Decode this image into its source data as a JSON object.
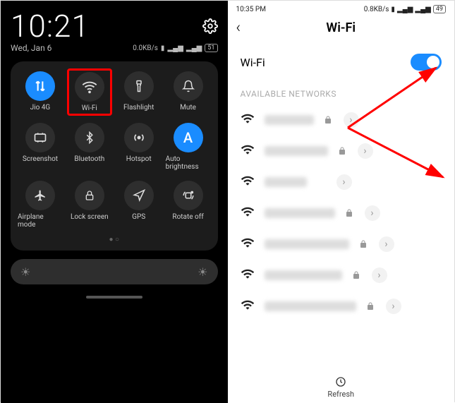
{
  "left": {
    "clock": "10:21",
    "date": "Wed, Jan 6",
    "data_rate": "0.0KB/s",
    "battery": "51",
    "tiles": [
      {
        "label": "Jio 4G",
        "icon": "updown",
        "active": true,
        "highlight": false
      },
      {
        "label": "Wi-Fi",
        "icon": "wifi",
        "active": false,
        "highlight": true
      },
      {
        "label": "Flashlight",
        "icon": "torch",
        "active": false,
        "highlight": false
      },
      {
        "label": "Mute",
        "icon": "bell",
        "active": false,
        "highlight": false
      },
      {
        "label": "Screenshot",
        "icon": "scissors",
        "active": false,
        "highlight": false
      },
      {
        "label": "Bluetooth",
        "icon": "bt",
        "active": false,
        "highlight": false
      },
      {
        "label": "Hotspot",
        "icon": "hotspot",
        "active": false,
        "highlight": false
      },
      {
        "label": "Auto brightness",
        "icon": "A",
        "active": true,
        "highlight": false
      },
      {
        "label": "Airplane mode",
        "icon": "plane",
        "active": false,
        "highlight": false
      },
      {
        "label": "Lock screen",
        "icon": "lock",
        "active": false,
        "highlight": false
      },
      {
        "label": "GPS",
        "icon": "nav",
        "active": false,
        "highlight": false
      },
      {
        "label": "Rotate off",
        "icon": "rotate",
        "active": false,
        "highlight": false
      }
    ]
  },
  "right": {
    "status_time": "10:35 PM",
    "data_rate": "0.8KB/s",
    "battery": "49",
    "title": "Wi-Fi",
    "toggle_label": "Wi-Fi",
    "toggle_on": true,
    "section_label": "AVAILABLE NETWORKS",
    "networks": [
      {
        "locked": true
      },
      {
        "locked": true
      },
      {
        "locked": false
      },
      {
        "locked": true
      },
      {
        "locked": true
      },
      {
        "locked": true
      },
      {
        "locked": true
      }
    ],
    "refresh_label": "Refresh"
  }
}
